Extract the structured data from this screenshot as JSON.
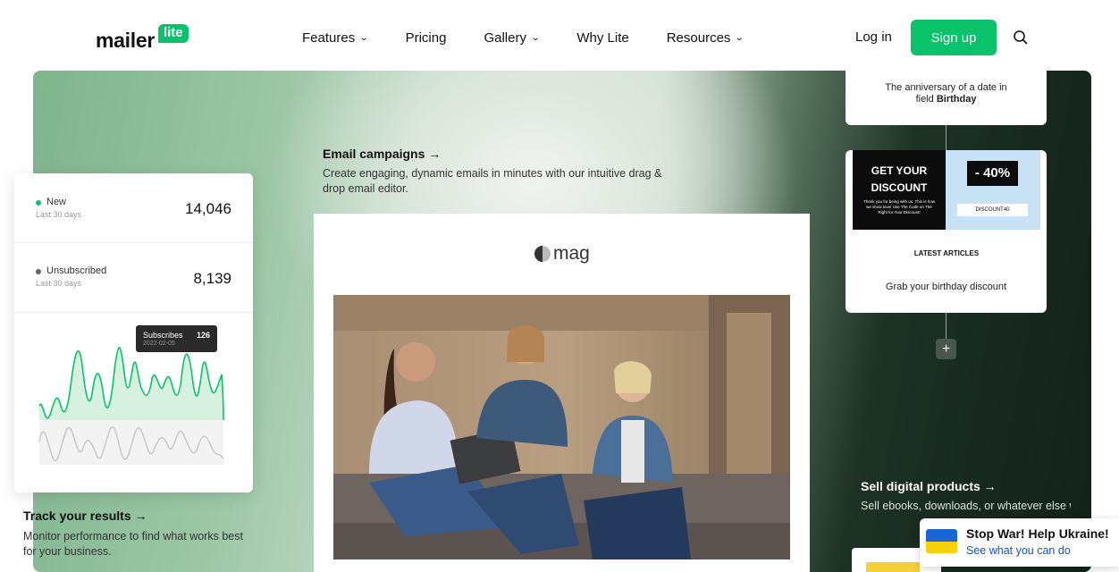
{
  "brand": {
    "name": "mailer",
    "badge": "lite",
    "accent": "#09c269"
  },
  "nav": {
    "links": [
      {
        "label": "Features",
        "dropdown": true
      },
      {
        "label": "Pricing",
        "dropdown": false
      },
      {
        "label": "Gallery",
        "dropdown": true
      },
      {
        "label": "Why Lite",
        "dropdown": false
      },
      {
        "label": "Resources",
        "dropdown": true
      }
    ],
    "login": "Log in",
    "signup": "Sign up",
    "search_icon": "search-icon"
  },
  "stats": {
    "new_label": "New",
    "new_period": "Last 30 days",
    "new_value": "14,046",
    "unsub_label": "Unsubscribed",
    "unsub_period": "Last 30 days",
    "unsub_value": "8,139",
    "tooltip_label": "Subscribes",
    "tooltip_date": "2022-02-05",
    "tooltip_value": "126"
  },
  "features": {
    "track_title": "Track your results →",
    "track_desc": "Monitor performance to find what works best for your business.",
    "email_title": "Email campaigns →",
    "email_desc": "Create engaging, dynamic emails in minutes with our intuitive drag & drop email editor.",
    "sell_title": "Sell digital products →",
    "sell_desc": "Sell ebooks, downloads, or whatever else will help you grow"
  },
  "email_preview": {
    "logo_text": "mag"
  },
  "automation": {
    "birthday_line1": "The anniversary of a date in",
    "birthday_line2_prefix": "field ",
    "birthday_line2_bold": "Birthday",
    "promo_heading_1": "GET YOUR",
    "promo_heading_2": "DISCOUNT",
    "promo_small": "Thank you for being with us. This is how we show love! Use The Code on The Right for Your Discount!",
    "promo_percent": "- 40%",
    "promo_code": "DISCOUNT40",
    "latest_articles": "LATEST ARTICLES",
    "promo_footer": "Grab your birthday discount",
    "add_step": "+"
  },
  "banner": {
    "title": "Stop War! Help Ukraine!",
    "link": "See what you can do"
  }
}
